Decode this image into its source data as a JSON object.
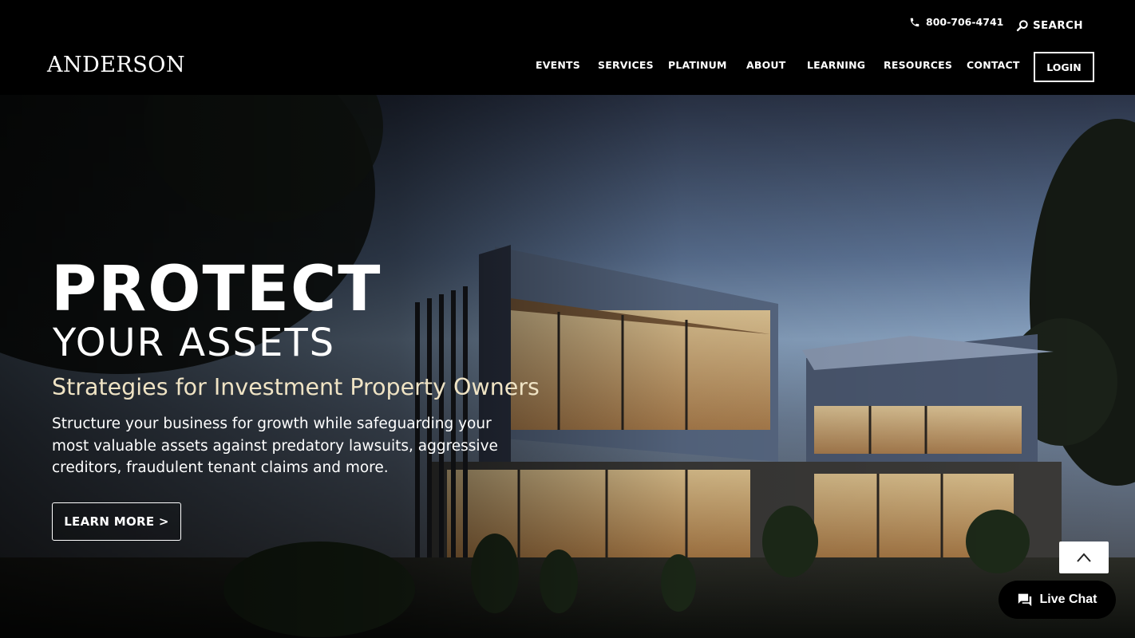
{
  "header": {
    "logo": "ANDERSON",
    "phone": "800-706-4741",
    "search_label": "SEARCH",
    "nav": [
      "EVENTS",
      "SERVICES",
      "PLATINUM",
      "ABOUT",
      "LEARNING",
      "RESOURCES",
      "CONTACT"
    ],
    "login_label": "LOGIN"
  },
  "hero": {
    "headline_1": "PROTECT",
    "headline_2": "YOUR ASSETS",
    "subhead": "Strategies for Investment Property Owners",
    "body": "Structure your business for growth while safeguarding your most valuable assets against predatory lawsuits, aggressive creditors, fraudulent tenant claims and more.",
    "cta_label": "LEARN MORE >"
  },
  "widgets": {
    "live_chat_label": "Live Chat"
  },
  "colors": {
    "header_bg": "#000000",
    "subhead": "#efe3c4",
    "text": "#ffffff"
  },
  "icons": [
    "phone-icon",
    "search-icon",
    "chevron-up-icon",
    "chat-icon"
  ]
}
